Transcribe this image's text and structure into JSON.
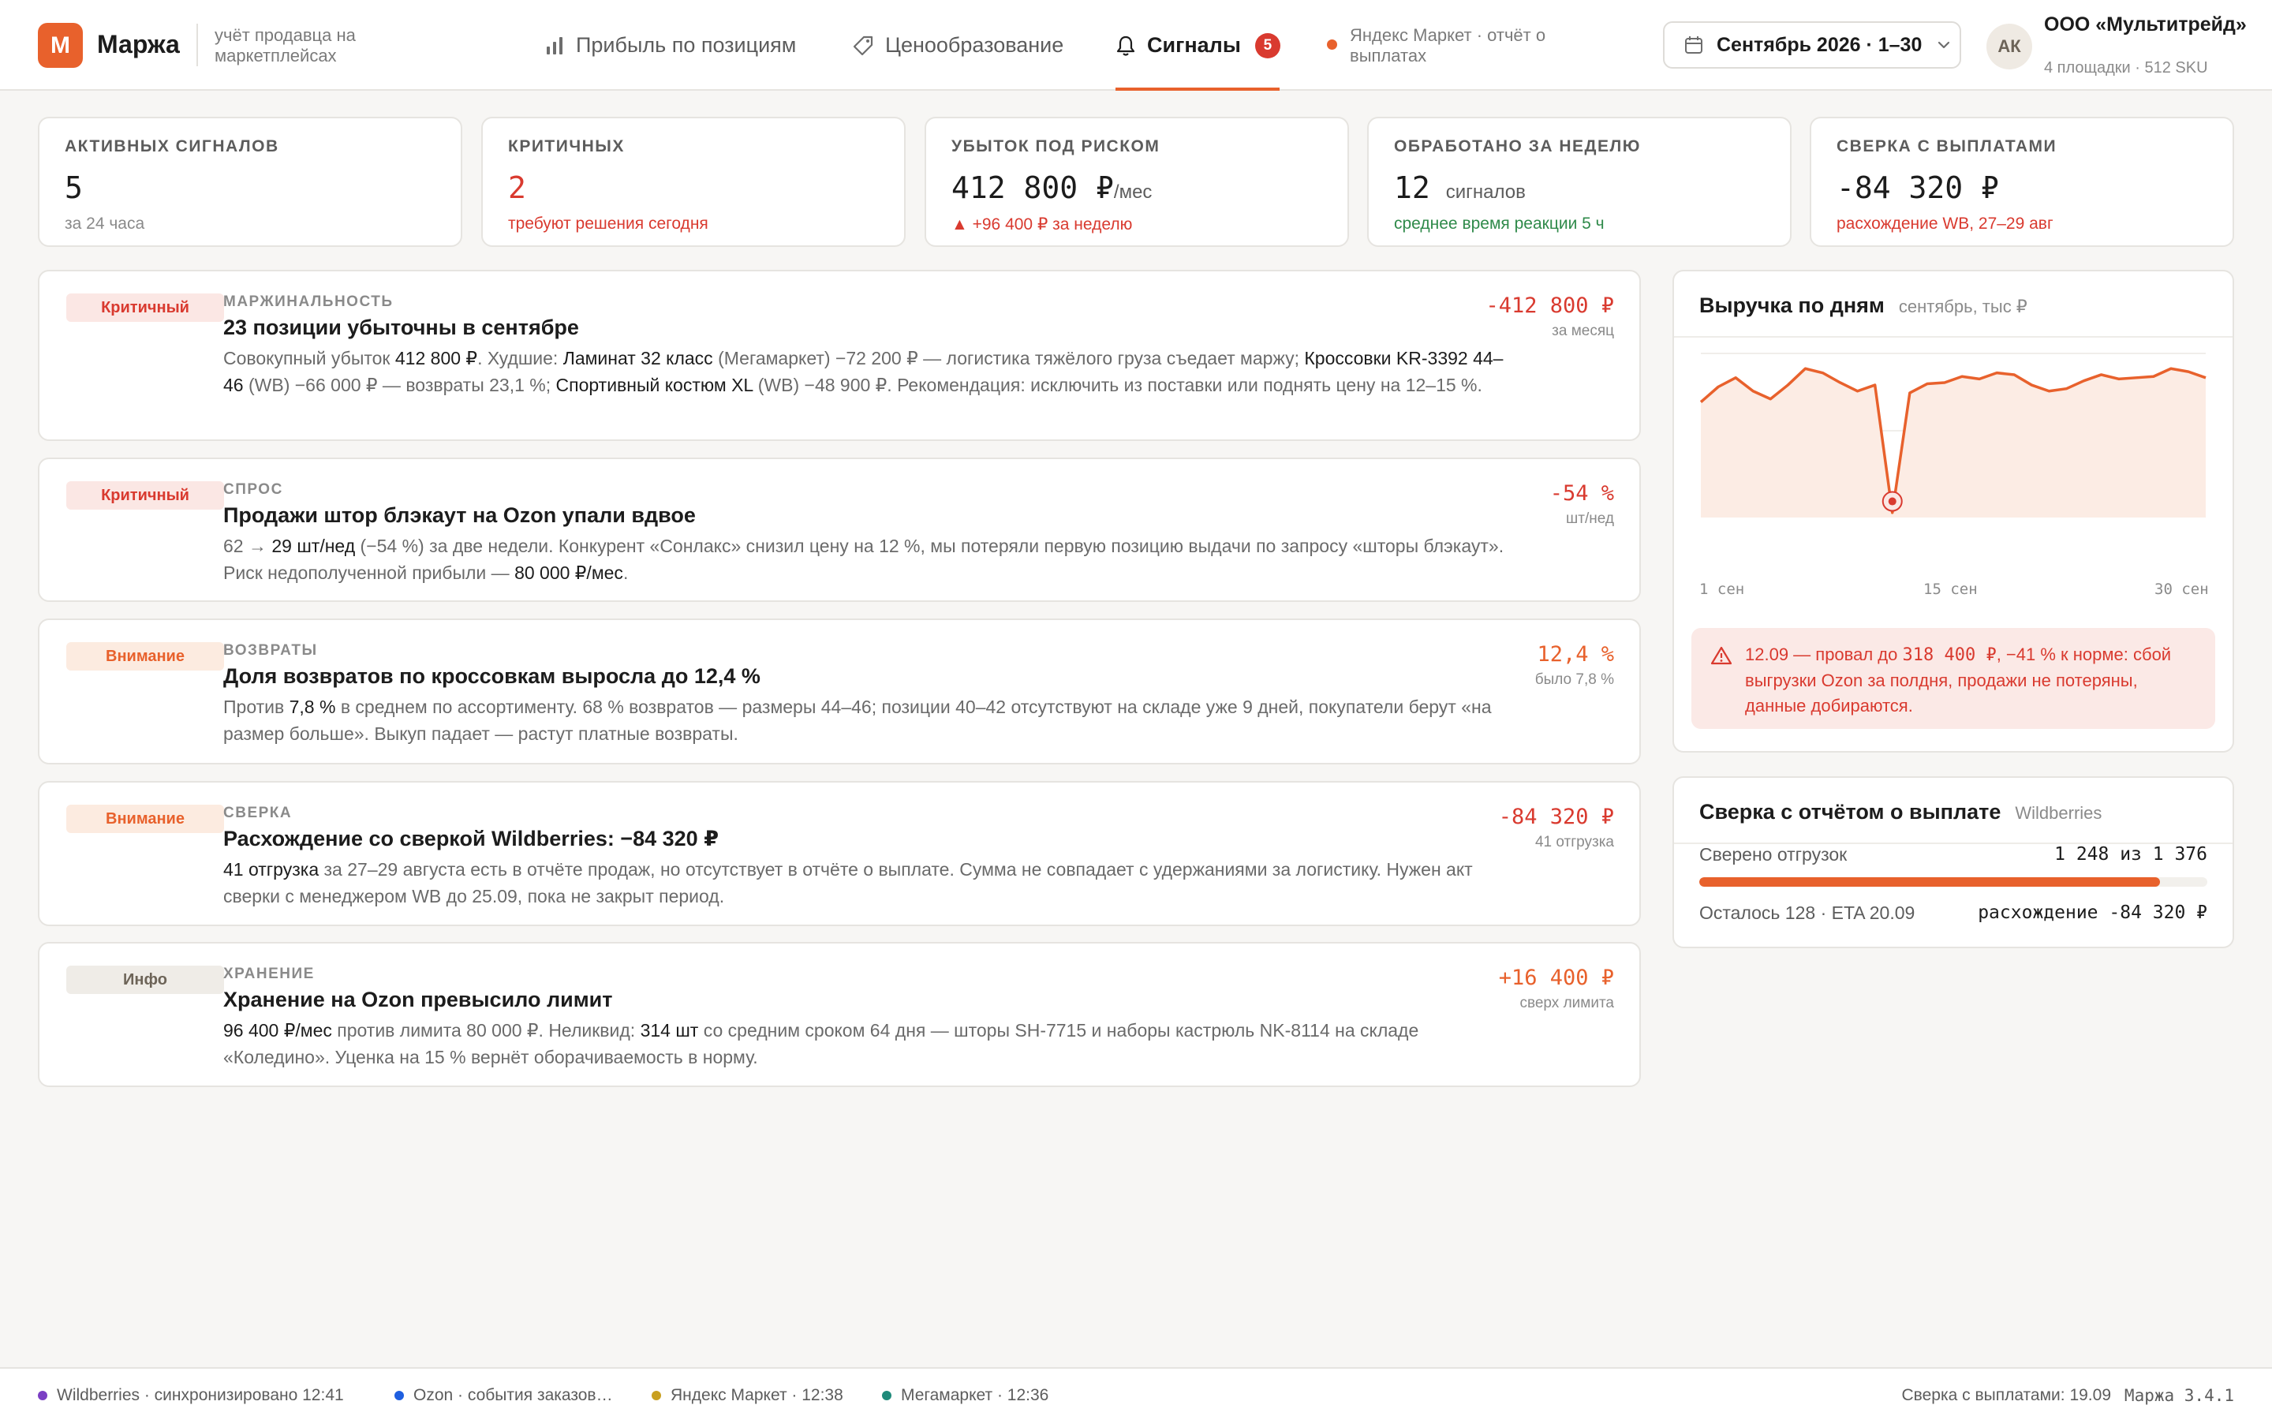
{
  "app": {
    "logo_letter": "М",
    "name": "Маржа",
    "subtitle": "учёт продавца на маркетплейсах"
  },
  "nav": {
    "profit": "Прибыль по позициям",
    "pricing": "Ценообразование",
    "signals": "Сигналы",
    "signals_count": "5",
    "ym_note": "Яндекс Маркет · отчёт о выплатах"
  },
  "period": {
    "label": "Сентябрь 2026 · 1–30"
  },
  "account": {
    "initials": "АК",
    "org": "ООО «Мультитрейд»",
    "meta": "4 площадки · 512 SKU"
  },
  "kpis": [
    {
      "label": "Активных сигналов",
      "value": "5",
      "unit": "",
      "sub": "за 24 часа"
    },
    {
      "label": "Критичных",
      "value": "2",
      "unit": "",
      "sub": "требуют решения сегодня"
    },
    {
      "label": "Убыток под риском",
      "value": "412 800 ₽",
      "unit": "/мес",
      "sub": "▲ +96 400 ₽ за неделю"
    },
    {
      "label": "Обработано за неделю",
      "value": "12",
      "unit": "сигналов",
      "sub": "среднее время реакции 5 ч"
    },
    {
      "label": "Сверка с выплатами",
      "value": "-84 320 ₽",
      "unit": "",
      "sub": "расхождение WB, 27–29 авг"
    }
  ],
  "signals": [
    {
      "severity": "Критичный",
      "category": "Маржинальность",
      "title": "23 позиции убыточны в сентябре",
      "desc": [
        "Совокупный убыток ",
        "412 800 ₽",
        ". Худшие: ",
        "Ламинат 32 класс",
        " (Мегамаркет) −72 200 ₽ — логистика тяжёлого груза съедает маржу; ",
        "Кроссовки KR-3392 44–46",
        " (WB) −66 000 ₽ — возвраты 23,1 %; ",
        "Спортивный костюм XL",
        " (WB) −48 900 ₽. Рекомендация: исключить из поставки или поднять цену на 12–15 %."
      ],
      "metric": "-412 800 ₽",
      "metric_caption": "за месяц"
    },
    {
      "severity": "Критичный",
      "category": "Спрос",
      "title": "Продажи штор блэкаут на Ozon упали вдвое",
      "desc": [
        "62 → ",
        "29 шт/нед",
        " (−54 %) за две недели. Конкурент «Сонлакс» снизил цену на 12 %, мы потеряли первую позицию выдачи по запросу «шторы блэкаут». Риск недополученной прибыли — ",
        "80 000 ₽/мес",
        "."
      ],
      "metric": "-54 %",
      "metric_caption": "шт/нед"
    },
    {
      "severity": "Внимание",
      "category": "Возвраты",
      "title": "Доля возвратов по кроссовкам выросла до 12,4 %",
      "desc": [
        "Против ",
        "7,8 %",
        " в среднем по ассортименту. 68 % возвратов — размеры 44–46; позиции 40–42 отсутствуют на складе уже 9 дней, покупатели берут «на размер больше». Выкуп падает — растут платные возвраты."
      ],
      "metric": "12,4 %",
      "metric_caption": "было 7,8 %"
    },
    {
      "severity": "Внимание",
      "category": "Сверка",
      "title": "Расхождение со сверкой Wildberries: −84 320 ₽",
      "desc": [
        "",
        "41 отгрузка",
        " за 27–29 августа есть в отчёте продаж, но отсутствует в отчёте о выплате. Сумма не совпадает с удержаниями за логистику. Нужен акт сверки с менеджером WB до 25.09, пока не закрыт период."
      ],
      "metric": "-84 320 ₽",
      "metric_caption": "41 отгрузка"
    },
    {
      "severity": "Инфо",
      "category": "Хранение",
      "title": "Хранение на Ozon превысило лимит",
      "desc": [
        "",
        "96 400 ₽/мес",
        " против лимита 80 000 ₽. Неликвид: ",
        "314 шт",
        " со средним сроком 64 дня — шторы SH-7715 и наборы кастрюль NK-8114 на складе «Коледино». Уценка на 15 % вернёт оборачиваемость в норму."
      ],
      "metric": "+16 400 ₽",
      "metric_caption": "сверх лимита"
    }
  ],
  "revenue_panel": {
    "title": "Выручка по дням",
    "subtitle": "сентябрь, тыс ₽",
    "x_ticks": [
      "1 сен",
      "15 сен",
      "30 сен"
    ],
    "alert_prefix": "12.09 — провал до ",
    "alert_value": "318 400 ₽",
    "alert_suffix": ", −41 % к норме: сбой выгрузки Ozon за полдня, продажи не потеряны, данные добираются."
  },
  "chart_data": {
    "type": "area",
    "title": "Выручка по дням",
    "subtitle": "сентябрь, тыс ₽",
    "x": [
      1,
      2,
      3,
      4,
      5,
      6,
      7,
      8,
      9,
      10,
      11,
      12,
      13,
      14,
      15,
      16,
      17,
      18,
      19,
      20,
      21,
      22,
      23,
      24,
      25,
      26,
      27,
      28,
      29,
      30
    ],
    "series": [
      {
        "values": [
          500,
          525,
          540,
          518,
          505,
          528,
          555,
          548,
          532,
          518,
          528,
          318,
          515,
          530,
          532,
          542,
          538,
          548,
          545,
          528,
          518,
          522,
          535,
          545,
          538,
          540,
          542,
          555,
          550,
          540
        ]
      }
    ],
    "highlight": {
      "x": 12,
      "y": 318.4
    },
    "ylim": [
      310,
      580
    ],
    "grid": true,
    "color": "#e8612c"
  },
  "recon_panel": {
    "title": "Сверка с отчётом о выплате",
    "source": "Wildberries",
    "checked_label": "Сверено отгрузок",
    "checked_value": "1 248 из 1 376",
    "progress": 0.907,
    "remaining": "Осталось 128 · ETA 20.09",
    "diff": "расхождение -84 320 ₽"
  },
  "footer": {
    "sources": [
      {
        "label": "Wildberries · синхронизировано 12:41",
        "color": "#7b3fc4"
      },
      {
        "label": "Ozon · события заказов…",
        "color": "#1f5fe0"
      },
      {
        "label": "Яндекс Маркет · 12:38",
        "color": "#c9a020"
      },
      {
        "label": "Мегамаркет · 12:36",
        "color": "#1f8a7a"
      }
    ],
    "recon_date": "Сверка с выплатами: 19.09",
    "version": "Маржа 3.4.1"
  },
  "colors": {
    "accent": "#e8612c",
    "danger": "#d93a2f",
    "success": "#2f8a4a"
  }
}
